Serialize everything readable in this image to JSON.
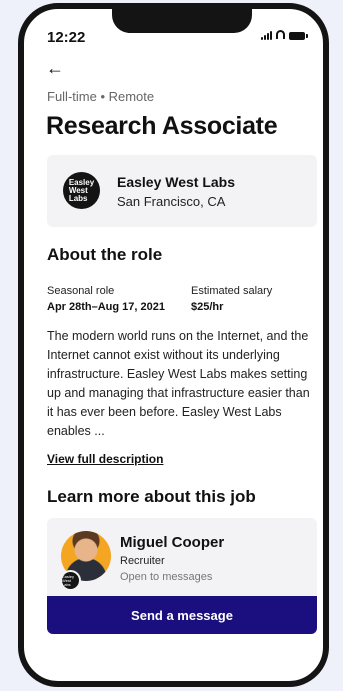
{
  "status_bar": {
    "time": "12:22"
  },
  "header": {
    "back_icon": "←"
  },
  "job": {
    "meta": "Full-time • Remote",
    "title": "Research Associate"
  },
  "company": {
    "logo_text": "Easley\nWest\nLabs",
    "name": "Easley West Labs",
    "location": "San Francisco, CA"
  },
  "about": {
    "heading": "About the role",
    "seasonal_label": "Seasonal role",
    "seasonal_value": "Apr 28th–Aug 17, 2021",
    "salary_label": "Estimated salary",
    "salary_value": "$25/hr",
    "description": "The modern world runs on the Internet, and the Internet cannot exist without its underlying infrastructure. Easley West Labs makes setting up and managing that infrastructure easier than it has ever been before. Easley West Labs enables ...",
    "view_link": "View full description"
  },
  "learn_more": {
    "heading": "Learn more about this job",
    "recruiter_name": "Miguel Cooper",
    "recruiter_role": "Recruiter",
    "recruiter_status": "Open to messages",
    "badge_text": "Easley West Labs",
    "button_label": "Send a message"
  },
  "colors": {
    "accent": "#1b0e7e",
    "card_bg": "#f3f3f5",
    "page_bg": "#eef0fa"
  }
}
